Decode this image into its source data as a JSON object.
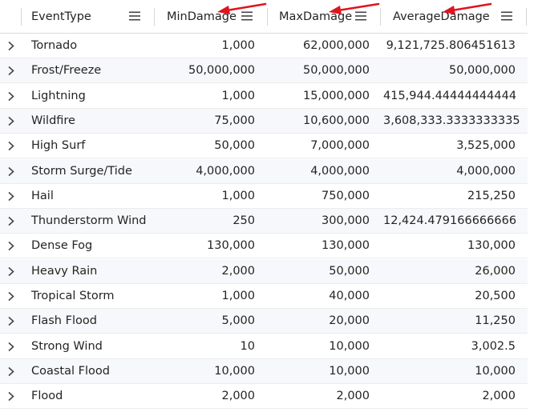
{
  "columns": [
    {
      "label": "EventType"
    },
    {
      "label": "MinDamage"
    },
    {
      "label": "MaxDamage"
    },
    {
      "label": "AverageDamage"
    }
  ],
  "rows": [
    {
      "event": "Tornado",
      "min": "1,000",
      "max": "62,000,000",
      "avg": "9,121,725.806451613"
    },
    {
      "event": "Frost/Freeze",
      "min": "50,000,000",
      "max": "50,000,000",
      "avg": "50,000,000"
    },
    {
      "event": "Lightning",
      "min": "1,000",
      "max": "15,000,000",
      "avg": "415,944.44444444444"
    },
    {
      "event": "Wildfire",
      "min": "75,000",
      "max": "10,600,000",
      "avg": "3,608,333.3333333335"
    },
    {
      "event": "High Surf",
      "min": "50,000",
      "max": "7,000,000",
      "avg": "3,525,000"
    },
    {
      "event": "Storm Surge/Tide",
      "min": "4,000,000",
      "max": "4,000,000",
      "avg": "4,000,000"
    },
    {
      "event": "Hail",
      "min": "1,000",
      "max": "750,000",
      "avg": "215,250"
    },
    {
      "event": "Thunderstorm Wind",
      "min": "250",
      "max": "300,000",
      "avg": "12,424.479166666666"
    },
    {
      "event": "Dense Fog",
      "min": "130,000",
      "max": "130,000",
      "avg": "130,000"
    },
    {
      "event": "Heavy Rain",
      "min": "2,000",
      "max": "50,000",
      "avg": "26,000"
    },
    {
      "event": "Tropical Storm",
      "min": "1,000",
      "max": "40,000",
      "avg": "20,500"
    },
    {
      "event": "Flash Flood",
      "min": "5,000",
      "max": "20,000",
      "avg": "11,250"
    },
    {
      "event": "Strong Wind",
      "min": "10",
      "max": "10,000",
      "avg": "3,002.5"
    },
    {
      "event": "Coastal Flood",
      "min": "10,000",
      "max": "10,000",
      "avg": "10,000"
    },
    {
      "event": "Flood",
      "min": "2,000",
      "max": "2,000",
      "avg": "2,000"
    }
  ],
  "annotation_color": "#e0141e"
}
